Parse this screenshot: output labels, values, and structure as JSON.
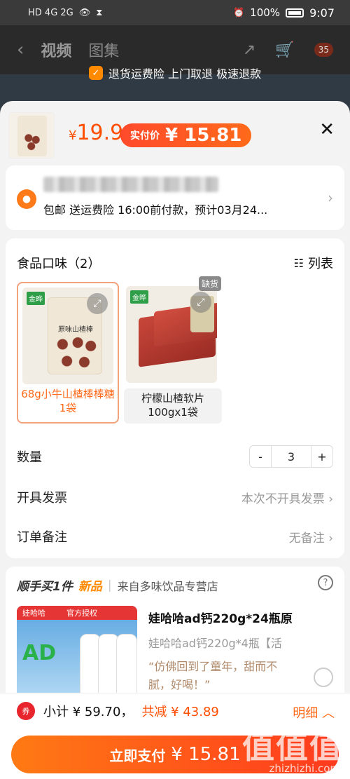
{
  "status_bar": {
    "left_icons": "HD 4G 2G",
    "battery": "100%",
    "time": "9:07"
  },
  "background_nav": {
    "tab1": "视频",
    "tab2": "图集",
    "cart_count": "35"
  },
  "notice": "退货运费险 上门取退 极速退款",
  "header": {
    "price_symbol": "¥",
    "price": "19.9",
    "real_price_label": "实付价",
    "real_price": "¥ 15.81"
  },
  "address": {
    "line": "包邮  送运费险  16:00前付款，预计03月24..."
  },
  "spec": {
    "title": "食品口味（2）",
    "list_label": "列表",
    "options": [
      {
        "label": "68g小牛山楂棒棒糖1袋",
        "bag_title": "原味山楂棒",
        "brand": "金晔"
      },
      {
        "label": "柠檬山楂软片100gx1袋",
        "badge": "缺货",
        "brand": "金晔"
      }
    ]
  },
  "quantity": {
    "label": "数量",
    "minus": "-",
    "value": "3",
    "plus": "+"
  },
  "invoice": {
    "label": "开具发票",
    "value": "本次不开具发票"
  },
  "remark": {
    "label": "订单备注",
    "value": "无备注"
  },
  "extra": {
    "title": "顺手买1件",
    "tag": "新品",
    "store": "来自多味饮品专营店",
    "product_title": "娃哈哈ad钙220g*24瓶原",
    "product_sub": "娃哈哈ad钙220g*4瓶【活",
    "quote": "“仿佛回到了童年，甜而不腻，好喝！”",
    "image_brand": "娃哈哈",
    "image_banner": "官方授权"
  },
  "bottom": {
    "subtotal": "小计 ¥ 59.70，",
    "saved": "共减 ¥ 43.89",
    "detail": "明细",
    "pay_label": "立即支付",
    "pay_amount": "¥ 15.81"
  },
  "watermark": {
    "text": "值值值",
    "url": "zhizhizhi.com"
  }
}
